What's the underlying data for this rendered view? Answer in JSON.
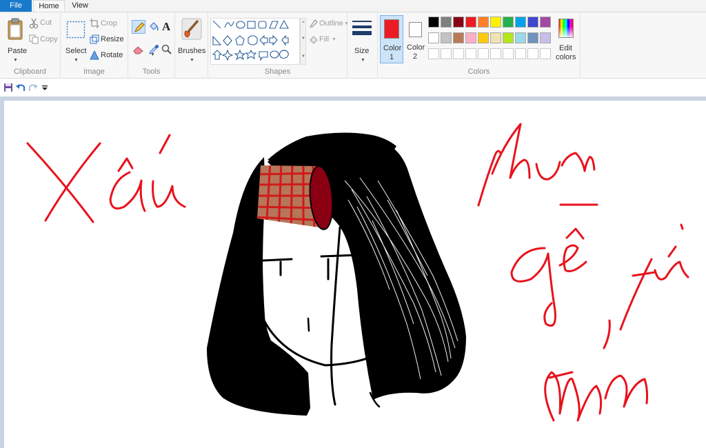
{
  "tabs": {
    "file": "File",
    "home": "Home",
    "view": "View"
  },
  "clipboard": {
    "paste": "Paste",
    "cut": "Cut",
    "copy": "Copy",
    "label": "Clipboard"
  },
  "image": {
    "select": "Select",
    "crop": "Crop",
    "resize": "Resize",
    "rotate": "Rotate",
    "label": "Image"
  },
  "tools": {
    "label": "Tools",
    "text_tool": "A"
  },
  "brushes": {
    "label": "Brushes"
  },
  "shapes": {
    "outline": "Outline",
    "fill": "Fill",
    "label": "Shapes"
  },
  "size": {
    "label": "Size"
  },
  "colors": {
    "color1_label": "Color",
    "color1_num": "1",
    "color2_label": "Color",
    "color2_num": "2",
    "edit1": "Edit",
    "edit2": "colors",
    "label": "Colors",
    "color1_value": "#ed1c24",
    "color2_value": "#ffffff",
    "palette_row1": [
      "#000000",
      "#7f7f7f",
      "#880015",
      "#ed1c24",
      "#ff7f27",
      "#fff200",
      "#22b14c",
      "#00a2e8",
      "#3f48cc",
      "#a349a4"
    ],
    "palette_row2": [
      "#ffffff",
      "#c3c3c3",
      "#b97a57",
      "#ffaec9",
      "#ffc90e",
      "#efe4b0",
      "#b5e61d",
      "#99d9ea",
      "#7092be",
      "#c8bfe7"
    ],
    "palette_row3": [
      "",
      "",
      "",
      "",
      "",
      "",
      "",
      "",
      "",
      ""
    ]
  },
  "drawing": {
    "ink_color": "#e8121c",
    "hair_color": "#000000",
    "roller_color": "#b5765a",
    "roller_end_color": "#8a0012",
    "roller_grid_color": "#d01a1a"
  }
}
